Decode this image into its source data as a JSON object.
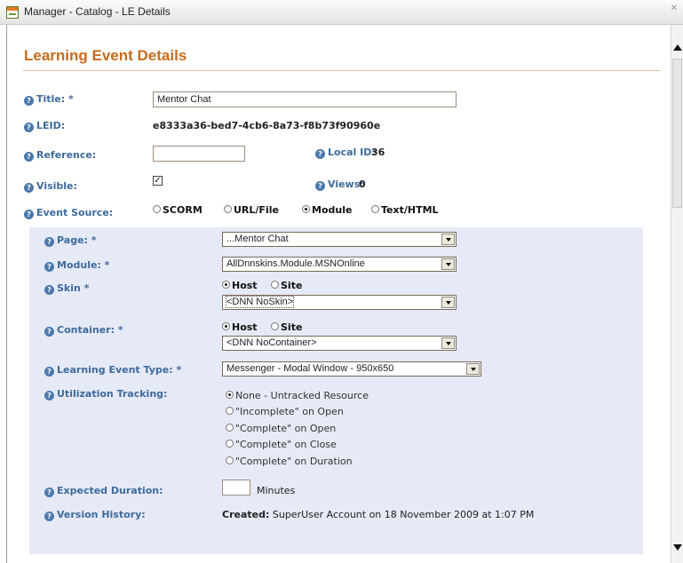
{
  "window": {
    "title": "Manager - Catalog - LE Details"
  },
  "page": {
    "heading": "Learning Event Details"
  },
  "help_glyph": "?",
  "fields": {
    "title": {
      "label": "Title: *",
      "value": "Mentor Chat"
    },
    "leid": {
      "label": "LEID:",
      "value": "e8333a36-bed7-4cb6-8a73-f8b73f90960e"
    },
    "reference": {
      "label": "Reference:",
      "value": ""
    },
    "local_id": {
      "label": "Local ID:",
      "value": "36"
    },
    "visible": {
      "label": "Visible:",
      "checked": true,
      "check_glyph": "✓"
    },
    "views": {
      "label": "Views:",
      "value": "0"
    },
    "event_source": {
      "label": "Event Source:",
      "options": [
        "SCORM",
        "URL/File",
        "Module",
        "Text/HTML"
      ],
      "selected": "Module"
    }
  },
  "panel": {
    "page": {
      "label": "Page: *",
      "value": "...Mentor Chat"
    },
    "module": {
      "label": "Module: *",
      "value": "AllDnnskins.Module.MSNOnline"
    },
    "skin": {
      "label": "Skin *",
      "options": [
        "Host",
        "Site"
      ],
      "selected": "Host",
      "value": "<DNN NoSkin>"
    },
    "container": {
      "label": "Container: *",
      "options": [
        "Host",
        "Site"
      ],
      "selected": "Host",
      "value": "<DNN NoContainer>"
    },
    "le_type": {
      "label": "Learning Event Type: *",
      "value": "Messenger - Modal Window - 950x650"
    },
    "tracking": {
      "label": "Utilization Tracking:",
      "options": [
        "None - Untracked Resource",
        "\"Incomplete\" on Open",
        "\"Complete\" on Open",
        "\"Complete\" on Close",
        "\"Complete\" on Duration"
      ],
      "selected": 0
    },
    "duration": {
      "label": "Expected Duration:",
      "value": "",
      "unit": "Minutes"
    },
    "version": {
      "label": "Version History:",
      "created_label": "Created:",
      "created_text": "SuperUser Account on 18 November 2009 at 1:07 PM"
    }
  },
  "colors": {
    "heading": "#c76b1d",
    "label": "#3d6b9c",
    "panel_bg": "#e6e9f6"
  }
}
